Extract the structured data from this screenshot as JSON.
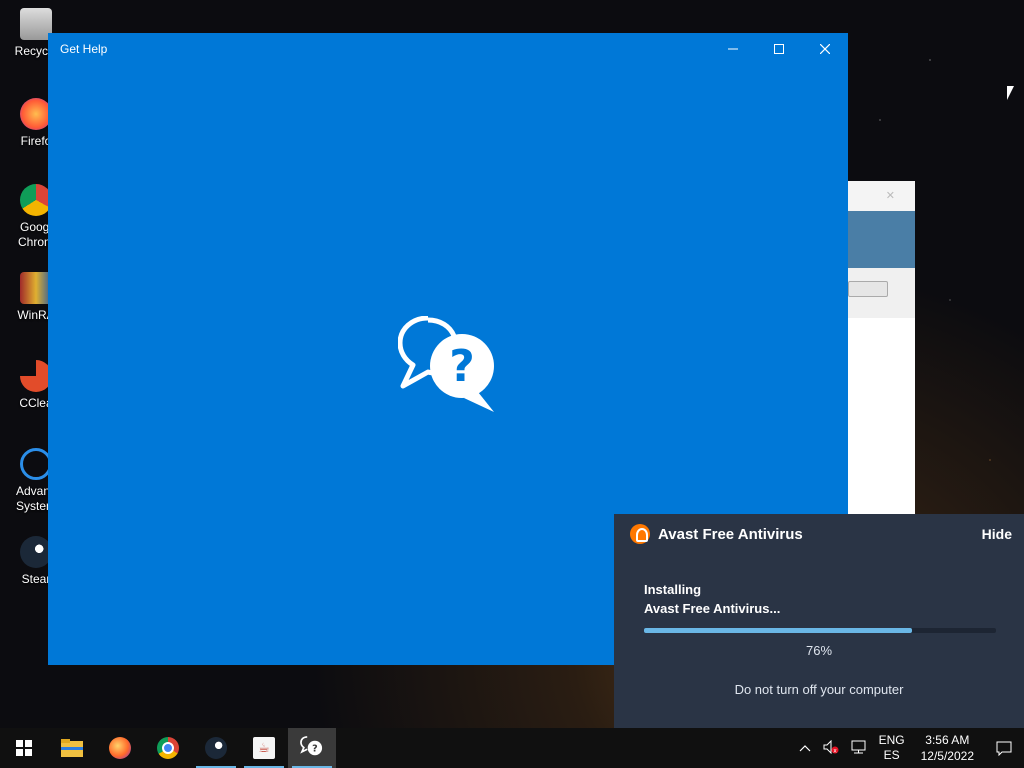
{
  "desktop": {
    "icons": [
      {
        "label": "Recycle",
        "name": "recycle-bin-icon"
      },
      {
        "label": "Firefo",
        "name": "firefox-desktop-icon"
      },
      {
        "label": "Googl Chrom",
        "name": "chrome-desktop-icon"
      },
      {
        "label": "WinRA",
        "name": "winrar-desktop-icon"
      },
      {
        "label": "CClea",
        "name": "ccleaner-desktop-icon"
      },
      {
        "label": "Advanc System",
        "name": "advanced-systemcare-desktop-icon"
      },
      {
        "label": "Stear",
        "name": "steam-desktop-icon"
      }
    ]
  },
  "get_help": {
    "title": "Get Help",
    "minimize_glyph": "—",
    "maximize_glyph": "☐",
    "close_glyph": "✕"
  },
  "avast": {
    "title": "Avast Free Antivirus",
    "hide_label": "Hide",
    "status_line1": "Installing",
    "status_line2": "Avast Free Antivirus...",
    "progress": 0.76,
    "percent_label": "76%",
    "note": "Do not turn off your computer",
    "accent": "#6ab7e6",
    "brand": "#ff7800"
  },
  "taskbar": {
    "items": [
      {
        "name": "start-button",
        "icon": "windows-icon"
      },
      {
        "name": "file-explorer-button",
        "icon": "folder-icon"
      },
      {
        "name": "firefox-button",
        "icon": "firefox-icon"
      },
      {
        "name": "chrome-button",
        "icon": "chrome-icon"
      },
      {
        "name": "steam-button",
        "icon": "steam-icon"
      },
      {
        "name": "java-installer-button",
        "icon": "java-icon"
      },
      {
        "name": "get-help-button",
        "icon": "help-icon"
      }
    ],
    "tray": {
      "lang_top": "ENG",
      "lang_bottom": "ES",
      "time": "3:56 AM",
      "date": "12/5/2022"
    }
  }
}
